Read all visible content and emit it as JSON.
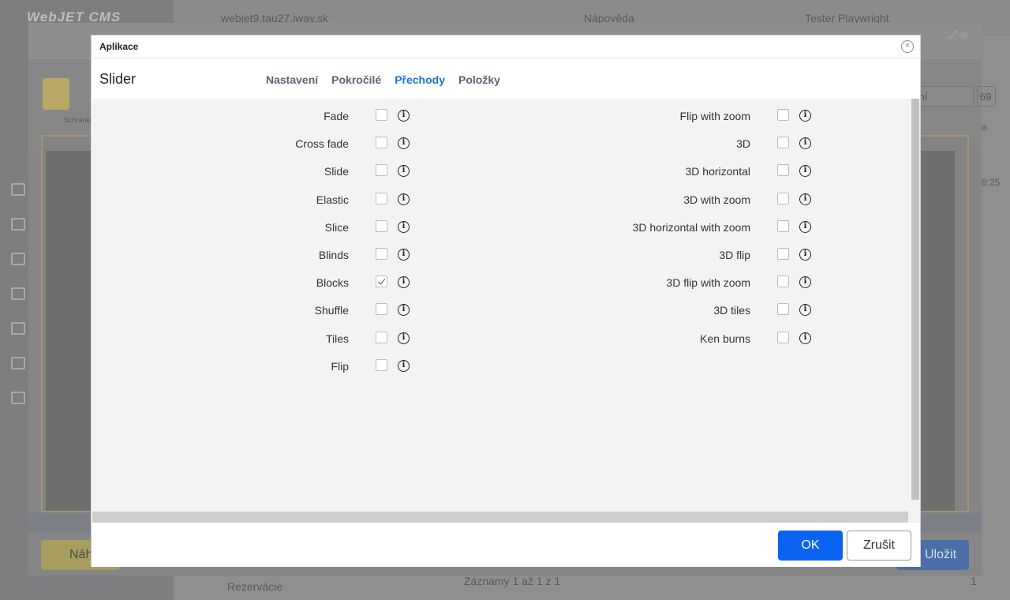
{
  "background": {
    "logo": "WebJET CMS",
    "header": {
      "domain": "webjet9.tau27.iway.sk",
      "help": "Nápověda",
      "user": "Tester Playwright"
    },
    "clipboard_label": "Schránka",
    "select_value": "rdní",
    "page_number": "69",
    "time_fragment": "8:25",
    "letter_fragment": "a",
    "folder_item": "Rezervácie",
    "records_info": "Záznamy 1 až 1 z 1",
    "pagination_current": "1",
    "preview_button": "Náh",
    "save_button": "Uložit"
  },
  "modal": {
    "title": "Aplikace",
    "app_name": "Slider",
    "tabs": [
      {
        "label": "Nastavení",
        "active": false
      },
      {
        "label": "Pokročilé",
        "active": false
      },
      {
        "label": "Přechody",
        "active": true
      },
      {
        "label": "Položky",
        "active": false
      }
    ],
    "left_options": [
      {
        "label": "Fade",
        "checked": false
      },
      {
        "label": "Cross fade",
        "checked": false
      },
      {
        "label": "Slide",
        "checked": false
      },
      {
        "label": "Elastic",
        "checked": false
      },
      {
        "label": "Slice",
        "checked": false
      },
      {
        "label": "Blinds",
        "checked": false
      },
      {
        "label": "Blocks",
        "checked": true
      },
      {
        "label": "Shuffle",
        "checked": false
      },
      {
        "label": "Tiles",
        "checked": false
      },
      {
        "label": "Flip",
        "checked": false
      }
    ],
    "right_options": [
      {
        "label": "Flip with zoom",
        "checked": false
      },
      {
        "label": "3D",
        "checked": false
      },
      {
        "label": "3D horizontal",
        "checked": false
      },
      {
        "label": "3D with zoom",
        "checked": false
      },
      {
        "label": "3D horizontal with zoom",
        "checked": false
      },
      {
        "label": "3D flip",
        "checked": false
      },
      {
        "label": "3D flip with zoom",
        "checked": false
      },
      {
        "label": "3D tiles",
        "checked": false
      },
      {
        "label": "Ken burns",
        "checked": false
      }
    ],
    "info_glyph": "i",
    "ok_label": "OK",
    "cancel_label": "Zrušit"
  }
}
